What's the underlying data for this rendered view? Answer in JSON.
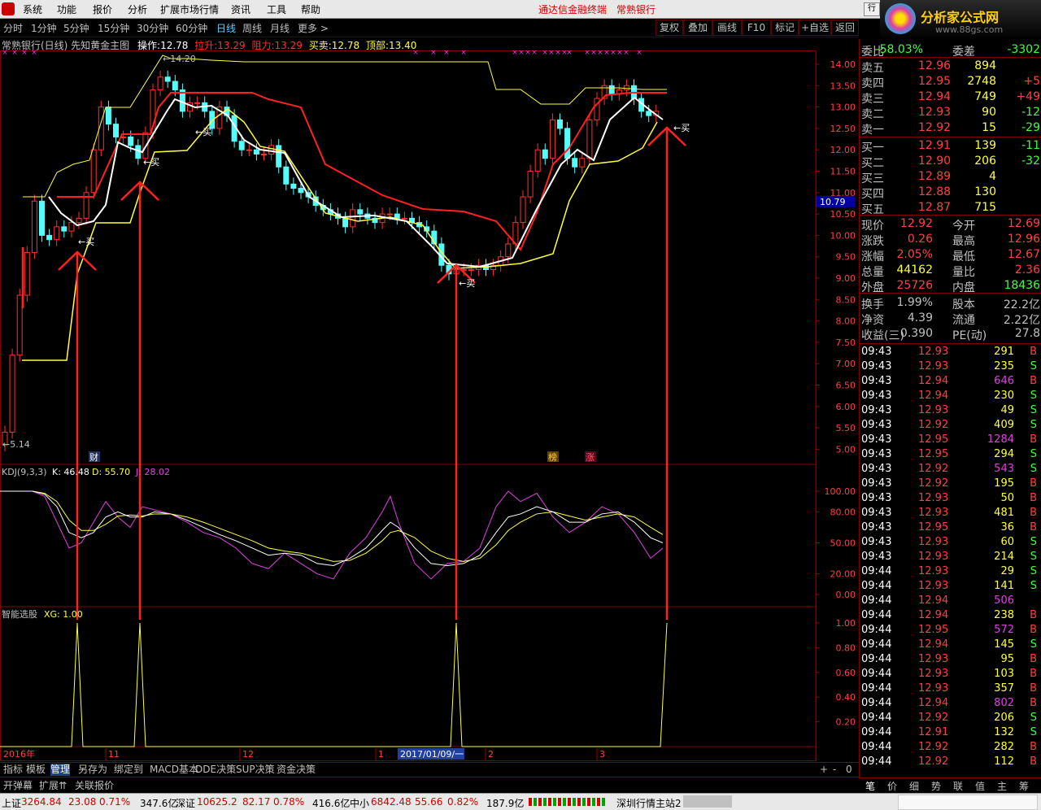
{
  "menu": {
    "items": [
      "系统",
      "功能",
      "报价",
      "分析",
      "扩展市场行情",
      "资讯",
      "工具",
      "帮助"
    ],
    "ad1": "通达信金融终端",
    "ad2": "常熟银行",
    "right_tab": "行"
  },
  "brand": {
    "title": "分析家公式网",
    "site": "www.88gs.com"
  },
  "toolbar": {
    "periods": [
      "分时",
      "1分钟",
      "5分钟",
      "15分钟",
      "30分钟",
      "60分钟",
      "日线",
      "周线",
      "月线",
      "更多 >"
    ],
    "active": "日线",
    "buttons": [
      "复权",
      "叠加",
      "画线",
      "F10",
      "标记",
      "+自选",
      "返回"
    ]
  },
  "info": {
    "name": "常熟银行(日线) 先知黄金主图",
    "op_label": "操作:",
    "op_value": "12.78",
    "lift_label": "拉升:",
    "lift_value": "13.29",
    "resist_label": "阻力:",
    "resist_value": "13.29",
    "trade_label": "买卖:",
    "trade_value": "12.78",
    "top_label": "顶部:",
    "top_value": "13.40"
  },
  "main_chart": {
    "high_label": "14.20",
    "low_label": "5.14",
    "buy_label": "买",
    "axis": [
      "14.00",
      "13.50",
      "13.00",
      "12.50",
      "12.00",
      "11.50",
      "11.00",
      "10.50",
      "10.00",
      "9.50",
      "9.00",
      "8.50",
      "8.00",
      "7.50",
      "7.00",
      "6.50",
      "6.00",
      "5.50",
      "5.00"
    ],
    "current_price": "10.79",
    "marker_cai": "财",
    "marker_bang": "榜",
    "marker_zhang": "涨"
  },
  "kdj": {
    "title": "KDJ(9,3,3)",
    "k": "K: 46.48",
    "d": "D: 55.70",
    "j": "J: 28.02",
    "axis": [
      "100.00",
      "80.00",
      "50.00",
      "20.00",
      "0.00"
    ]
  },
  "xg": {
    "title": "智能选股",
    "value": "XG: 1.00",
    "axis": [
      "1.00",
      "0.80",
      "0.60",
      "0.40",
      "0.20"
    ]
  },
  "time_axis": {
    "labels": [
      "2016年",
      "11",
      "12",
      "1",
      "2",
      "3"
    ],
    "highlight": "2017/01/09/一"
  },
  "index_tabs": [
    "指标",
    "模板",
    "管理",
    "另存为",
    "绑定到",
    "MACD基本",
    "DDE决策",
    "SUP决策",
    "资金决策"
  ],
  "index_tabs_active": "管理",
  "bottom2": [
    "开弹幕",
    "扩展⇈",
    "关联报价"
  ],
  "panel": {
    "weibi_label": "委比",
    "weibi_value": "-58.03%",
    "weicha_label": "委差",
    "weicha_value": "-3302",
    "asks": [
      {
        "label": "卖五",
        "price": "12.96",
        "vol": "894",
        "chg": ""
      },
      {
        "label": "卖四",
        "price": "12.95",
        "vol": "2748",
        "chg": "+5"
      },
      {
        "label": "卖三",
        "price": "12.94",
        "vol": "749",
        "chg": "+49"
      },
      {
        "label": "卖二",
        "price": "12.93",
        "vol": "90",
        "chg": "-12"
      },
      {
        "label": "卖一",
        "price": "12.92",
        "vol": "15",
        "chg": "-29"
      }
    ],
    "bids": [
      {
        "label": "买一",
        "price": "12.91",
        "vol": "139",
        "chg": "-11"
      },
      {
        "label": "买二",
        "price": "12.90",
        "vol": "206",
        "chg": "-32"
      },
      {
        "label": "买三",
        "price": "12.89",
        "vol": "4",
        "chg": ""
      },
      {
        "label": "买四",
        "price": "12.88",
        "vol": "130",
        "chg": ""
      },
      {
        "label": "买五",
        "price": "12.87",
        "vol": "715",
        "chg": ""
      }
    ],
    "stats": [
      {
        "l1": "现价",
        "v1": "12.92",
        "l2": "今开",
        "v2": "12.69",
        "c1": "#ff4040",
        "c2": "#ff4040"
      },
      {
        "l1": "涨跌",
        "v1": "0.26",
        "l2": "最高",
        "v2": "12.96",
        "c1": "#ff4040",
        "c2": "#ff4040"
      },
      {
        "l1": "涨幅",
        "v1": "2.05%",
        "l2": "最低",
        "v2": "12.67",
        "c1": "#ff4040",
        "c2": "#ff4040"
      },
      {
        "l1": "总量",
        "v1": "44162",
        "l2": "量比",
        "v2": "2.36",
        "c1": "#ffff40",
        "c2": "#ff4040"
      },
      {
        "l1": "外盘",
        "v1": "25726",
        "l2": "内盘",
        "v2": "18436",
        "c1": "#ff4040",
        "c2": "#40ff40"
      }
    ],
    "stats2": [
      {
        "l1": "换手",
        "v1": "1.99%",
        "l2": "股本",
        "v2": "22.2亿"
      },
      {
        "l1": "净资",
        "v1": "4.39",
        "l2": "流通",
        "v2": "2.22亿"
      },
      {
        "l1": "收益(三)",
        "v1": "0.390",
        "l2": "PE(动)",
        "v2": "27.8"
      }
    ],
    "ticks": [
      [
        "09:43",
        "12.93",
        "291",
        "B"
      ],
      [
        "09:43",
        "12.93",
        "235",
        "S"
      ],
      [
        "09:43",
        "12.94",
        "646",
        "B"
      ],
      [
        "09:43",
        "12.94",
        "230",
        "S"
      ],
      [
        "09:43",
        "12.93",
        "49",
        "S"
      ],
      [
        "09:43",
        "12.92",
        "409",
        "S"
      ],
      [
        "09:43",
        "12.95",
        "1284",
        "B"
      ],
      [
        "09:43",
        "12.95",
        "294",
        "S"
      ],
      [
        "09:43",
        "12.92",
        "543",
        "S"
      ],
      [
        "09:43",
        "12.92",
        "195",
        "B"
      ],
      [
        "09:43",
        "12.93",
        "50",
        "B"
      ],
      [
        "09:43",
        "12.93",
        "481",
        "B"
      ],
      [
        "09:43",
        "12.95",
        "36",
        "B"
      ],
      [
        "09:43",
        "12.93",
        "60",
        "S"
      ],
      [
        "09:43",
        "12.93",
        "214",
        "S"
      ],
      [
        "09:44",
        "12.93",
        "29",
        "S"
      ],
      [
        "09:44",
        "12.93",
        "141",
        "S"
      ],
      [
        "09:44",
        "12.94",
        "506",
        ""
      ],
      [
        "09:44",
        "12.94",
        "238",
        "B"
      ],
      [
        "09:44",
        "12.95",
        "572",
        "B"
      ],
      [
        "09:44",
        "12.94",
        "145",
        "S"
      ],
      [
        "09:44",
        "12.93",
        "95",
        "B"
      ],
      [
        "09:44",
        "12.93",
        "103",
        "B"
      ],
      [
        "09:44",
        "12.93",
        "357",
        "B"
      ],
      [
        "09:44",
        "12.94",
        "802",
        "B"
      ],
      [
        "09:44",
        "12.92",
        "206",
        "S"
      ],
      [
        "09:44",
        "12.91",
        "132",
        "S"
      ],
      [
        "09:44",
        "12.92",
        "282",
        "B"
      ],
      [
        "09:44",
        "12.92",
        "112",
        "B"
      ]
    ],
    "tabs": [
      "笔",
      "价",
      "细",
      "势",
      "联",
      "值",
      "主",
      "筹"
    ]
  },
  "status": {
    "sh_label": "上证",
    "sh_val": "3264.84",
    "sh_chg": "23.08",
    "sh_pct": "0.71%",
    "sh_amt": "347.6亿",
    "sz_label": "深证",
    "sz_val": "10625.2",
    "sz_chg": "82.17",
    "sz_pct": "0.78%",
    "sz_amt": "416.6亿",
    "zx_label": "中小",
    "zx_val": "6842.48",
    "zx_chg": "55.66",
    "zx_pct": "0.82%",
    "zx_amt": "187.9亿",
    "server": "深圳行情主站2"
  }
}
